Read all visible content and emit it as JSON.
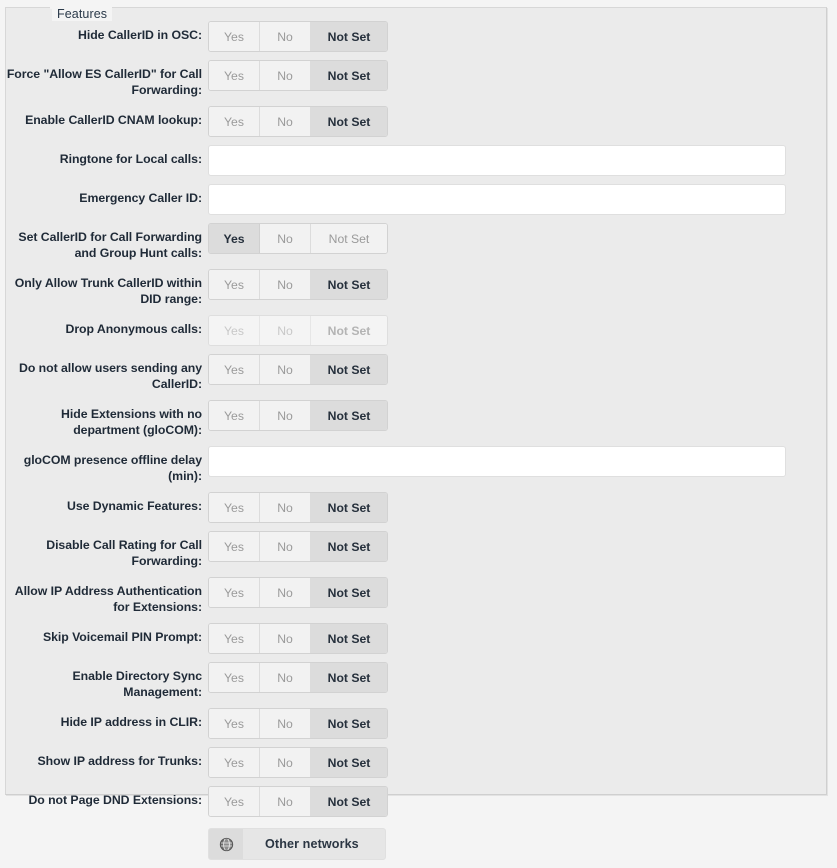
{
  "panel": {
    "legend": "Features"
  },
  "toggle_options": {
    "yes": "Yes",
    "no": "No",
    "not_set": "Not Set"
  },
  "rows": [
    {
      "type": "toggle",
      "label": "Hide CallerID in OSC:",
      "selected": "not_set",
      "disabled": false
    },
    {
      "type": "toggle",
      "label": "Force \"Allow ES CallerID\" for Call Forwarding:",
      "selected": "not_set",
      "disabled": false
    },
    {
      "type": "toggle",
      "label": "Enable CallerID CNAM lookup:",
      "selected": "not_set",
      "disabled": false
    },
    {
      "type": "text",
      "label": "Ringtone for Local calls:",
      "value": "",
      "placeholder": ""
    },
    {
      "type": "text",
      "label": "Emergency Caller ID:",
      "value": "",
      "placeholder": ""
    },
    {
      "type": "toggle",
      "label": "Set CallerID for Call Forwarding and Group Hunt calls:",
      "selected": "yes",
      "disabled": false
    },
    {
      "type": "toggle",
      "label": "Only Allow Trunk CallerID within DID range:",
      "selected": "not_set",
      "disabled": false
    },
    {
      "type": "toggle",
      "label": "Drop Anonymous calls:",
      "selected": "not_set",
      "disabled": true
    },
    {
      "type": "toggle",
      "label": "Do not allow users sending any CallerID:",
      "selected": "not_set",
      "disabled": false
    },
    {
      "type": "toggle",
      "label": "Hide Extensions with no department (gloCOM):",
      "selected": "not_set",
      "disabled": false
    },
    {
      "type": "text",
      "label": "gloCOM presence offline delay (min):",
      "value": "",
      "placeholder": ""
    },
    {
      "type": "toggle",
      "label": "Use Dynamic Features:",
      "selected": "not_set",
      "disabled": false
    },
    {
      "type": "toggle",
      "label": "Disable Call Rating for Call Forwarding:",
      "selected": "not_set",
      "disabled": false
    },
    {
      "type": "toggle",
      "label": "Allow IP Address Authentication for Extensions:",
      "selected": "not_set",
      "disabled": false
    },
    {
      "type": "toggle",
      "label": "Skip Voicemail PIN Prompt:",
      "selected": "not_set",
      "disabled": false
    },
    {
      "type": "toggle",
      "label": "Enable Directory Sync Management:",
      "selected": "not_set",
      "disabled": false
    },
    {
      "type": "toggle",
      "label": "Hide IP address in CLIR:",
      "selected": "not_set",
      "disabled": false
    },
    {
      "type": "toggle",
      "label": "Show IP address for Trunks:",
      "selected": "not_set",
      "disabled": false
    },
    {
      "type": "toggle",
      "label": "Do not Page DND Extensions:",
      "selected": "not_set",
      "disabled": false
    }
  ],
  "actions": {
    "other_networks": {
      "label": "Other networks",
      "icon": "globe-icon"
    }
  },
  "colors": {
    "panel_bg": "#ebebeb",
    "page_bg": "#f4f4f4",
    "segment_bg": "#f2f2f2",
    "segment_active_bg": "#dcdcdc",
    "label_text": "#1f2a37",
    "muted_text": "#9a9a9a",
    "input_bg": "#ffffff",
    "border": "#d2d2d2"
  }
}
